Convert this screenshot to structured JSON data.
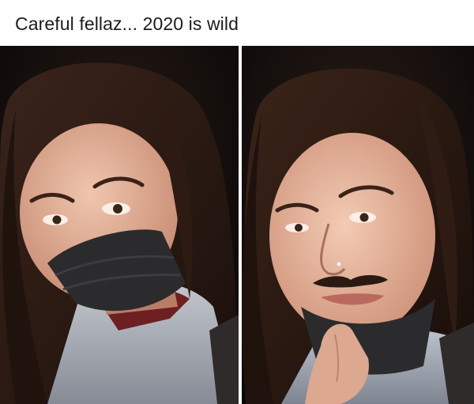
{
  "post": {
    "caption": "Careful fellaz... 2020 is wild"
  },
  "panels": [
    {
      "subject": "woman-wearing-black-face-mask"
    },
    {
      "subject": "woman-with-mask-pulled-down-revealing-mustache"
    }
  ],
  "colors": {
    "background": "#ffffff",
    "caption_text": "#1c1c1c",
    "photo_dark": "#0b0908",
    "hair": "#2a1a13",
    "skin": "#e2b49c",
    "mask": "#2b2b2d",
    "hoodie": "#a9adb5"
  }
}
